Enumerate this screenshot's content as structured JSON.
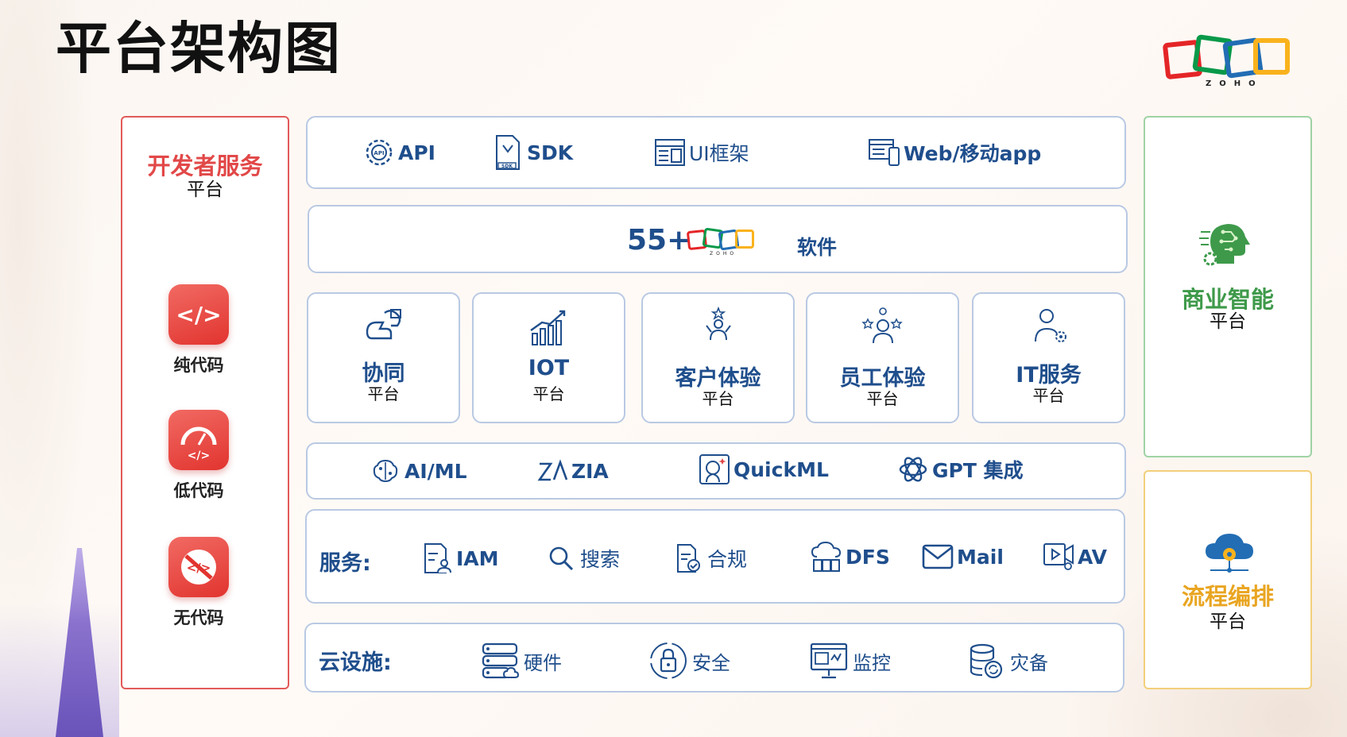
{
  "title": "平台架构图",
  "logo": {
    "word": "ZOHO",
    "colors": [
      "#e42527",
      "#089949",
      "#226db4",
      "#f9b21d"
    ]
  },
  "dev_platform": {
    "title": "开发者服务",
    "subtitle": "平台",
    "items": [
      {
        "label": "纯代码",
        "icon": "code-icon"
      },
      {
        "label": "低代码",
        "icon": "gauge-code-icon"
      },
      {
        "label": "无代码",
        "icon": "no-code-icon"
      }
    ]
  },
  "top_row": [
    {
      "label": "API",
      "icon": "api-gear-icon"
    },
    {
      "label": "SDK",
      "icon": "sdk-file-icon"
    },
    {
      "label": "UI框架",
      "icon": "ui-layout-icon"
    },
    {
      "label": "Web/移动app",
      "icon": "web-mobile-icon"
    }
  ],
  "software_row": {
    "count": "55+",
    "brand": "ZOHO",
    "suffix": "软件"
  },
  "platforms": [
    {
      "title": "协同",
      "subtitle": "平台",
      "icon": "collaboration-icon"
    },
    {
      "title": "IOT",
      "subtitle": "平台",
      "icon": "growth-chart-icon"
    },
    {
      "title": "客户体验",
      "subtitle": "平台",
      "icon": "customer-icon"
    },
    {
      "title": "员工体验",
      "subtitle": "平台",
      "icon": "employee-icon"
    },
    {
      "title": "IT服务",
      "subtitle": "平台",
      "icon": "it-service-icon"
    }
  ],
  "ai_row": [
    {
      "label": "AI/ML",
      "icon": "brain-icon"
    },
    {
      "label": "ZIA",
      "icon": "zia-icon"
    },
    {
      "label": "QuickML",
      "icon": "quickml-icon"
    },
    {
      "label": "GPT 集成",
      "icon": "openai-icon"
    }
  ],
  "services_row": {
    "heading": "服务:",
    "items": [
      {
        "label": "IAM",
        "icon": "identity-icon"
      },
      {
        "label": "搜索",
        "icon": "search-icon"
      },
      {
        "label": "合规",
        "icon": "compliance-icon"
      },
      {
        "label": "DFS",
        "icon": "cloud-storage-icon"
      },
      {
        "label": "Mail",
        "icon": "mail-icon"
      },
      {
        "label": "AV",
        "icon": "video-icon"
      }
    ]
  },
  "infra_row": {
    "heading": "云设施:",
    "items": [
      {
        "label": "硬件",
        "icon": "server-icon"
      },
      {
        "label": "安全",
        "icon": "lock-icon"
      },
      {
        "label": "监控",
        "icon": "monitor-icon"
      },
      {
        "label": "灾备",
        "icon": "database-backup-icon"
      }
    ]
  },
  "bi_platform": {
    "title": "商业智能",
    "subtitle": "平台",
    "icon": "ai-head-icon",
    "color": "#3e9a4a"
  },
  "flow_platform": {
    "title": "流程编排",
    "subtitle": "平台",
    "icon": "cloud-gear-icon",
    "color": "#e9a521"
  },
  "colors": {
    "primary": "#1f4e8c",
    "dev_red": "#e24848",
    "box_border": "#b9c9e3"
  }
}
